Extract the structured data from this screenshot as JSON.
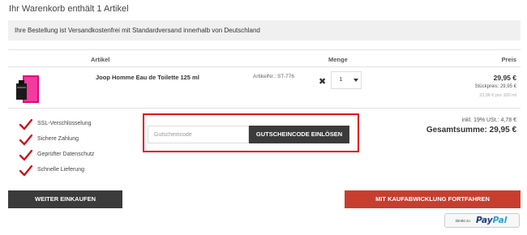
{
  "cart": {
    "heading": "Ihr Warenkorb enthält 1 Artikel",
    "shipping_notice": "Ihre Bestellung ist Versandkostenfrei mit Standardversand innerhalb von Deutschland"
  },
  "table": {
    "headers": {
      "article": "Artikel",
      "quantity": "Menge",
      "price": "Preis"
    }
  },
  "item": {
    "name": "Joop Homme Eau de Toilette 125 ml",
    "article_nr": "ArtikelNr.: ST-776",
    "remove_icon": "close-icon",
    "quantity": "1",
    "price": "29,95 €",
    "unit_price": "Stückpreis: 29,95 €",
    "base_price": "23,96 € pro 100 ml"
  },
  "features": [
    {
      "label": "SSL-Verschlüsselung",
      "icon": "check-icon"
    },
    {
      "label": "Sichere Zahlung",
      "icon": "check-icon"
    },
    {
      "label": "Geprüfter Datenschutz",
      "icon": "check-icon"
    },
    {
      "label": "Schnelle Lieferung",
      "icon": "check-icon"
    }
  ],
  "voucher": {
    "placeholder": "Gutscheincode",
    "button_label": "GUTSCHEINCODE EINLÖSEN"
  },
  "summary": {
    "tax": "inkl. 19% USt.: 4,78 €",
    "total": "Gesamtsumme: 29,95 €"
  },
  "actions": {
    "continue_label": "WEITER EINKAUFEN",
    "checkout_label": "MIT KAUFABWICKLUNG FORTFAHREN",
    "paypal_prefix": "Direkt zu",
    "paypal_pay": "Pay",
    "paypal_pal": "Pal"
  },
  "colors": {
    "accent_red": "#c73e2f",
    "highlight_frame": "#e30613",
    "dark_button": "#3b3b3b",
    "check_red": "#d1121a",
    "banner_bg": "#f0f0f0"
  }
}
